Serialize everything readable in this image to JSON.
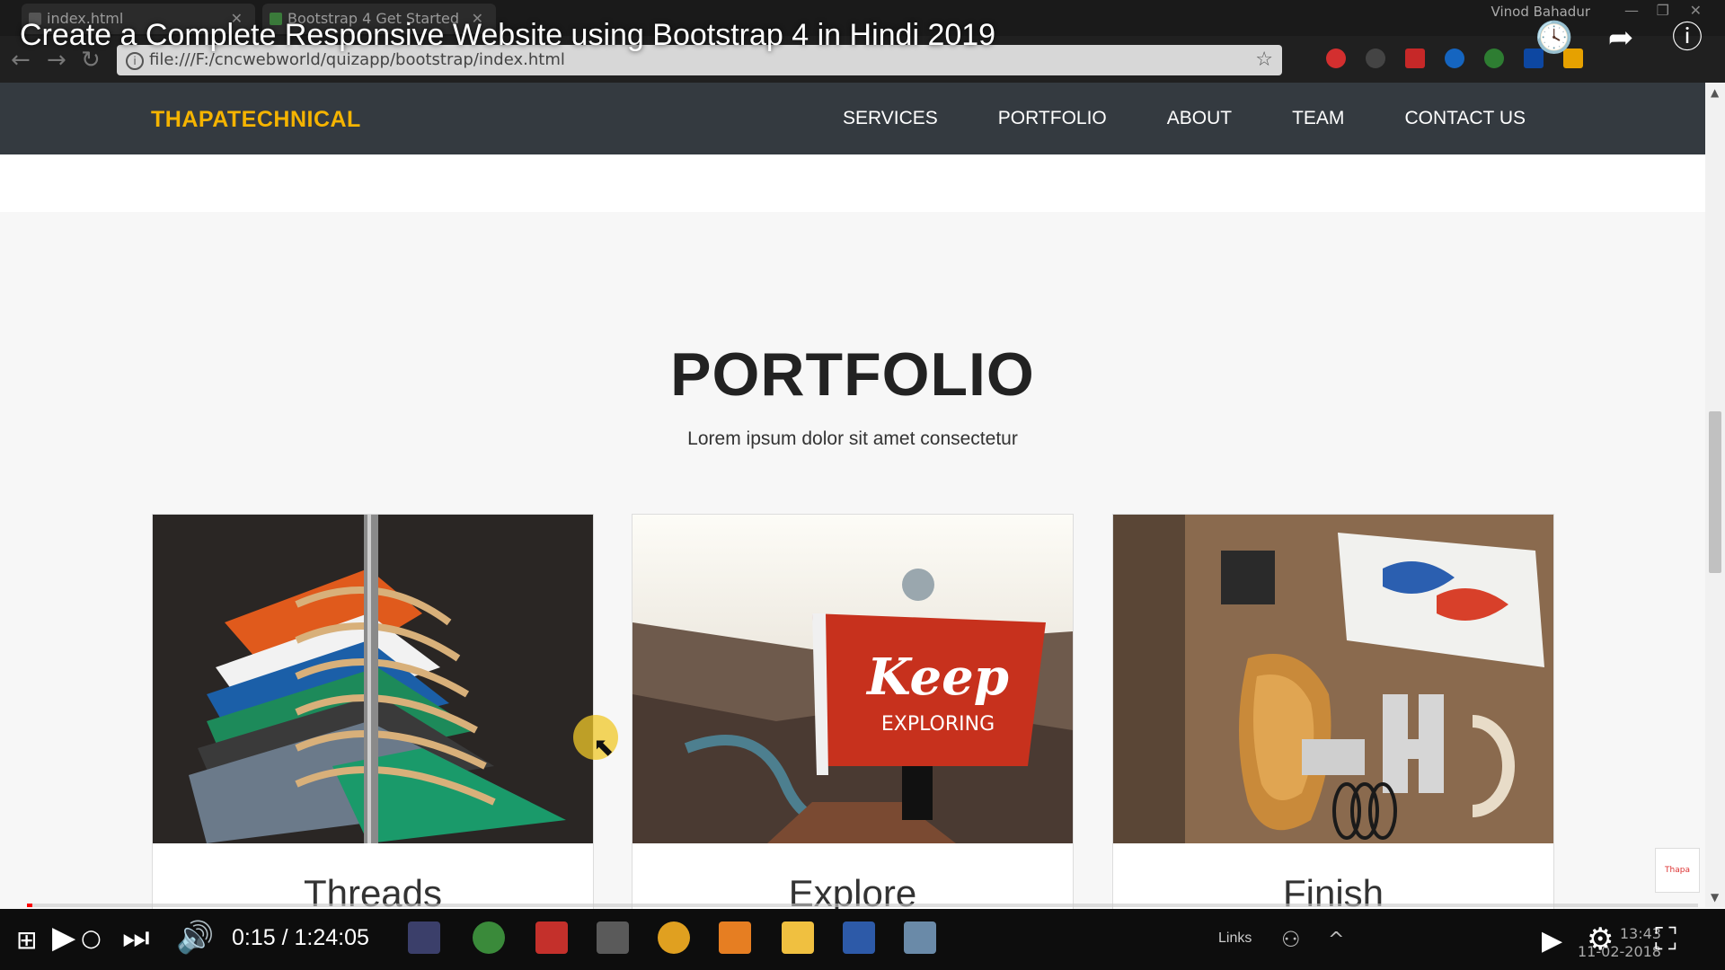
{
  "browser": {
    "tabs": [
      {
        "label": "index.html"
      },
      {
        "label": "Bootstrap 4 Get Started"
      }
    ],
    "user": "Vinod Bahadur",
    "url": "file:///F:/cncwebworld/quizapp/bootstrap/index.html"
  },
  "video": {
    "title": "Create a Complete Responsive Website using Bootstrap 4 in Hindi 2019",
    "time_display": "0:15 / 1:24:05",
    "progress_fraction": 0.002,
    "buffer_fraction": 0.02
  },
  "site": {
    "brand": "THAPATECHNICAL",
    "nav": [
      "SERVICES",
      "PORTFOLIO",
      "ABOUT",
      "TEAM",
      "CONTACT US"
    ],
    "section_title": "PORTFOLIO",
    "section_subtitle": "Lorem ipsum dolor sit amet consectetur",
    "cards": [
      {
        "title": "Threads",
        "image": "clothes-on-hangers"
      },
      {
        "title": "Explore",
        "image": "keep-exploring-flag"
      },
      {
        "title": "Finish",
        "image": "guitar-and-letters"
      }
    ],
    "colors": {
      "navbar": "#343a40",
      "brand": "#f5b400"
    }
  },
  "taskbar": {
    "links_label": "Links",
    "clock_time": "13:43",
    "clock_date": "11-02-2018"
  }
}
